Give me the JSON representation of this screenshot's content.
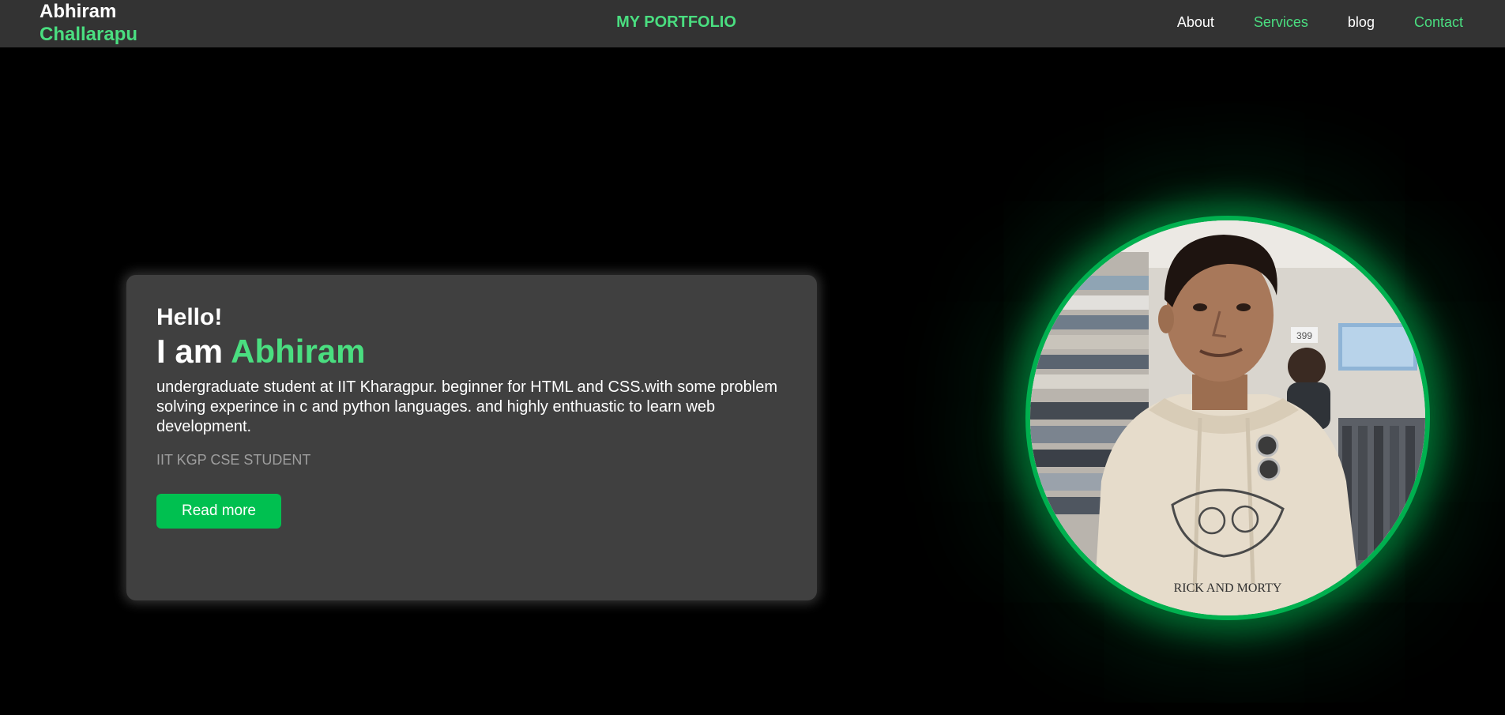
{
  "header": {
    "logo_first": "Abhiram",
    "logo_last": "Challarapu",
    "brand": "MY PORTFOLIO",
    "nav": [
      {
        "label": "About"
      },
      {
        "label": "Services"
      },
      {
        "label": "blog"
      },
      {
        "label": "Contact"
      }
    ]
  },
  "hero": {
    "greeting": "Hello!",
    "intro_prefix": "I am ",
    "intro_name": "Abhiram",
    "description": "undergraduate student at IIT Kharagpur. beginner for HTML and CSS.with some problem solving experince in c and python languages. and highly enthuastic to learn web development.",
    "role": "IIT KGP CSE STUDENT",
    "button_label": "Read more"
  },
  "photo": {
    "price_tag": "399",
    "shirt_print": "RICK AND MORTY"
  },
  "colors": {
    "accent": "#4ade80",
    "button": "#00c050",
    "nav_bg": "#333333",
    "card_bg": "#404040",
    "page_bg": "#000000"
  }
}
